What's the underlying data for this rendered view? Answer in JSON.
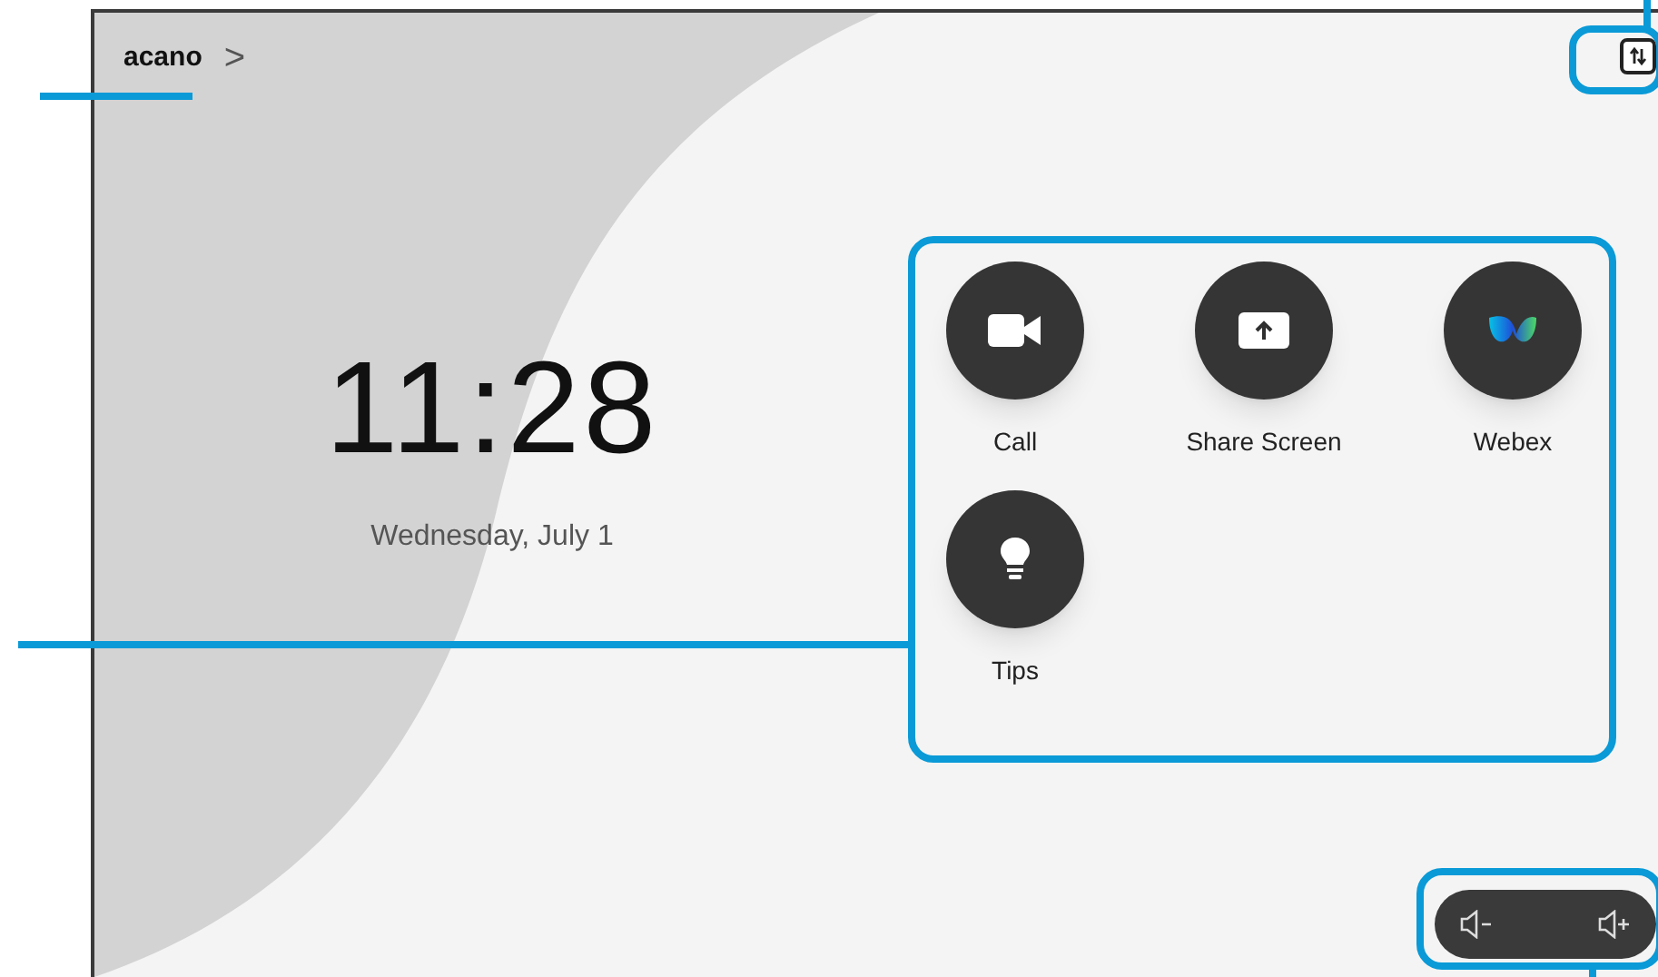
{
  "header": {
    "title": "acano",
    "chevron": ">"
  },
  "clock": {
    "time": "11:28",
    "date": "Wednesday, July 1"
  },
  "apps": [
    {
      "kind": "call",
      "label": "Call"
    },
    {
      "kind": "share",
      "label": "Share Screen"
    },
    {
      "kind": "webex",
      "label": "Webex"
    },
    {
      "kind": "tips",
      "label": "Tips"
    }
  ]
}
